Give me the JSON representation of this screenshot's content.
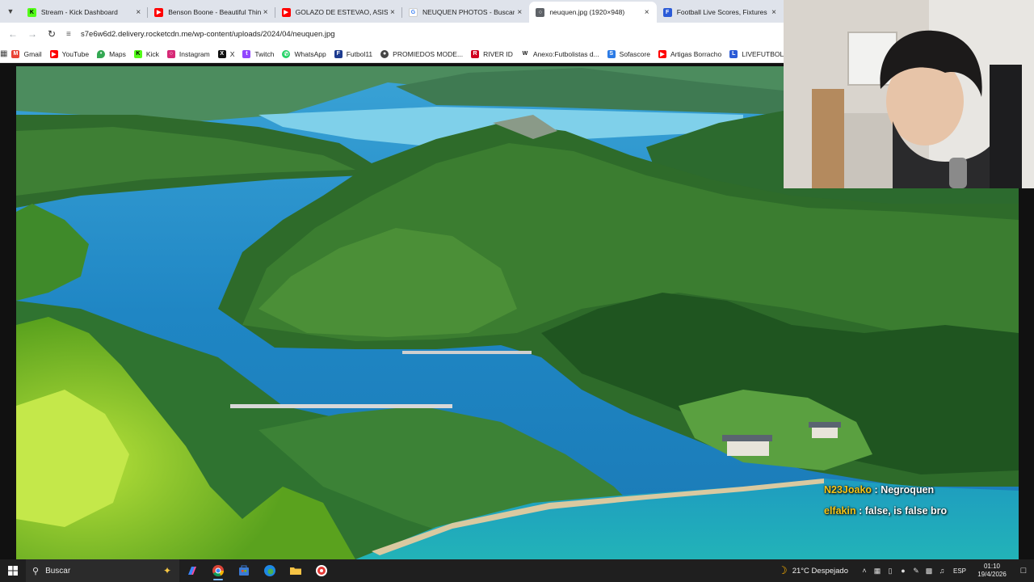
{
  "browser": {
    "tabs": [
      {
        "title": "Stream - Kick Dashboard",
        "icon": "kick-icon",
        "color": "#53fc18",
        "active": false
      },
      {
        "title": "Benson Boone - Beautiful Things",
        "icon": "youtube-icon",
        "color": "#ff0000",
        "active": false
      },
      {
        "title": "GOLAZO DE ESTEVAO, ASISTENCIA",
        "icon": "youtube-icon",
        "color": "#ff0000",
        "active": false
      },
      {
        "title": "NEUQUEN PHOTOS - Buscar con Google",
        "icon": "google-icon",
        "color": "#4285f4",
        "active": false
      },
      {
        "title": "neuquen.jpg (1920×948)",
        "icon": "globe-icon",
        "color": "#5f6368",
        "active": true
      },
      {
        "title": "Football Live Scores, Fixtures & Results",
        "icon": "livefutbol-icon",
        "color": "#2b5bd7",
        "active": false
      }
    ],
    "url": "s7e6w6d2.delivery.rocketcdn.me/wp-content/uploads/2024/04/neuquen.jpg",
    "bookmarks": [
      {
        "label": "Gmail",
        "icon": "gmail-icon",
        "color": "#ea4335"
      },
      {
        "label": "YouTube",
        "icon": "youtube-icon",
        "color": "#ff0000"
      },
      {
        "label": "Maps",
        "icon": "maps-icon",
        "color": "#34a853"
      },
      {
        "label": "Kick",
        "icon": "kick-icon",
        "color": "#53fc18"
      },
      {
        "label": "Instagram",
        "icon": "instagram-icon",
        "color": "#d62976"
      },
      {
        "label": "X",
        "icon": "x-icon",
        "color": "#111111"
      },
      {
        "label": "Twitch",
        "icon": "twitch-icon",
        "color": "#9146ff"
      },
      {
        "label": "WhatsApp",
        "icon": "whatsapp-icon",
        "color": "#25d366"
      },
      {
        "label": "Futbol11",
        "icon": "futbol11-icon",
        "color": "#1d3b8f"
      },
      {
        "label": "PROMIEDOS MODE...",
        "icon": "promiedos-icon",
        "color": "#444444"
      },
      {
        "label": "RIVER ID",
        "icon": "river-icon",
        "color": "#d1001f"
      },
      {
        "label": "Anexo:Futbolistas d...",
        "icon": "wikipedia-icon",
        "color": "#222222"
      },
      {
        "label": "Sofascore",
        "icon": "sofascore-icon",
        "color": "#2c7be5"
      },
      {
        "label": "Artigas Borracho",
        "icon": "youtube-icon",
        "color": "#ff0000"
      },
      {
        "label": "LIVEFUTBOL",
        "icon": "livefutbol-icon",
        "color": "#2b5bd7"
      }
    ]
  },
  "chat": [
    {
      "user": "N23Joako",
      "message": "Negroquen"
    },
    {
      "user": "elfakin",
      "message": "false, is false bro"
    }
  ],
  "taskbar": {
    "search_placeholder": "Buscar",
    "weather": "21°C Despejado",
    "language": "ESP",
    "time": "01:10",
    "date": "19/4/2026"
  }
}
